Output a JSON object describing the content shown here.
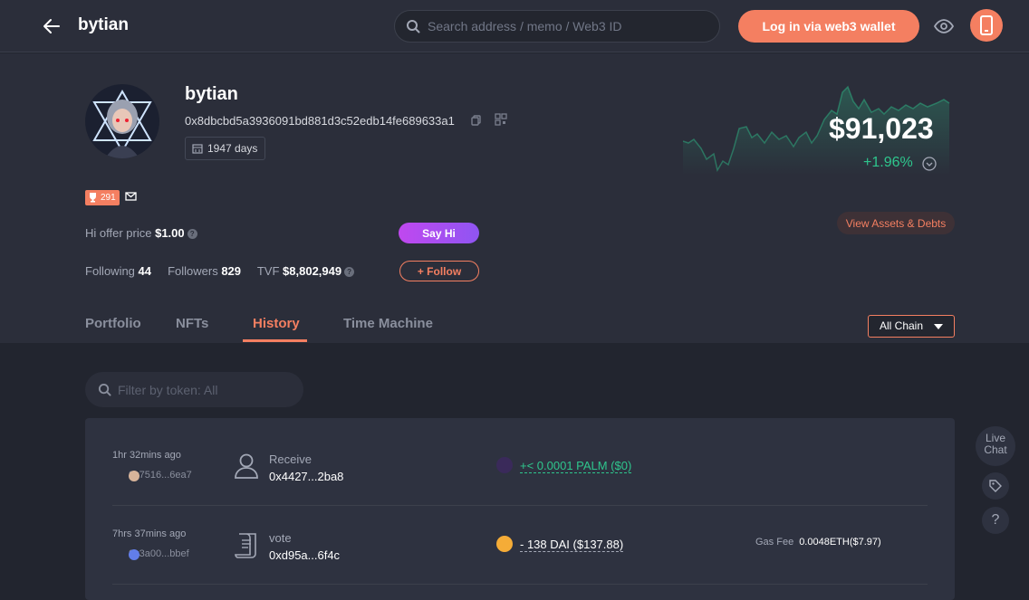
{
  "header": {
    "title": "bytian",
    "search_placeholder": "Search address / memo / Web3 ID",
    "login_label": "Log in via web3 wallet"
  },
  "profile": {
    "name": "bytian",
    "address": "0x8dbcbd5a3936091bd881d3c52edb14fe689633a1",
    "days": "1947 days",
    "badge_count": "291",
    "offer_label": "Hi offer price",
    "offer_value": "$1.00",
    "say_hi": "Say Hi",
    "following_label": "Following",
    "following": "44",
    "followers_label": "Followers",
    "followers": "829",
    "tvf_label": "TVF",
    "tvf": "$8,802,949",
    "follow_label": "+ Follow"
  },
  "balance": {
    "value": "$91,023",
    "change": "+1.96%",
    "view_assets": "View Assets & Debts"
  },
  "tabs": [
    {
      "label": "Portfolio"
    },
    {
      "label": "NFTs"
    },
    {
      "label": "History"
    },
    {
      "label": "Time Machine"
    }
  ],
  "chain_select": "All Chain",
  "filter_placeholder": "Filter by token: All",
  "history": [
    {
      "time": "1hr 32mins ago",
      "from": "0x7516...6ea7",
      "type": "Receive",
      "hash": "0x4427...2ba8",
      "amount": "+< 0.0001 PALM  ($0)",
      "amount_color": "#2ec68d",
      "token_color": "#6b3fa0"
    },
    {
      "time": "7hrs 37mins ago",
      "from": "0x3a00...bbef",
      "type": "vote",
      "hash": "0xd95a...6f4c",
      "amount": "- 138 DAI  ($137.88)",
      "amount_color": "#ffffff",
      "token_color": "#f5ac37",
      "gas_label": "Gas Fee",
      "gas_value": "0.0048ETH($7.97)"
    }
  ],
  "sidebar": {
    "live_chat": "Live Chat",
    "help": "?"
  },
  "colors": {
    "accent": "#f47f61",
    "positive": "#2ec68d",
    "bg": "#22252f"
  }
}
